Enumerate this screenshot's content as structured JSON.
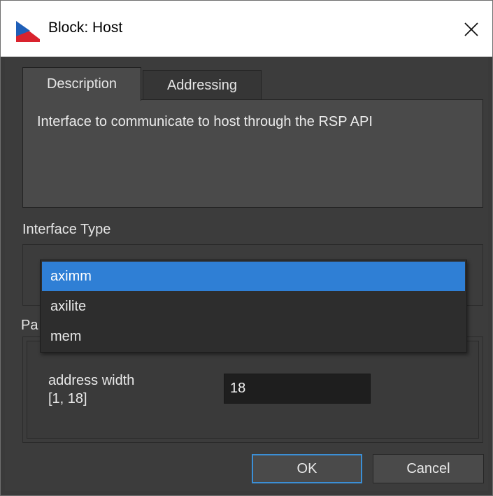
{
  "window": {
    "title": "Block: Host"
  },
  "tabs": [
    {
      "label": "Description",
      "active": true
    },
    {
      "label": "Addressing",
      "active": false
    }
  ],
  "description": {
    "text": "Interface to communicate to host through the RSP API"
  },
  "interface_type": {
    "label": "Interface Type",
    "options": [
      {
        "label": "aximm",
        "selected": true
      },
      {
        "label": "axilite",
        "selected": false
      },
      {
        "label": "mem",
        "selected": false
      }
    ]
  },
  "parameters": {
    "label_visible_fragment": "Pa",
    "address_width": {
      "label_line1": "address width",
      "label_line2": "[1, 18]",
      "value": "18"
    }
  },
  "buttons": {
    "ok": "OK",
    "cancel": "Cancel"
  },
  "colors": {
    "accent": "#2f7fd5",
    "ok_border": "#3b8fd6",
    "dialog_bg": "#3c3c3c"
  },
  "icons": {
    "app": "app-logo-icon",
    "close": "close-icon"
  }
}
